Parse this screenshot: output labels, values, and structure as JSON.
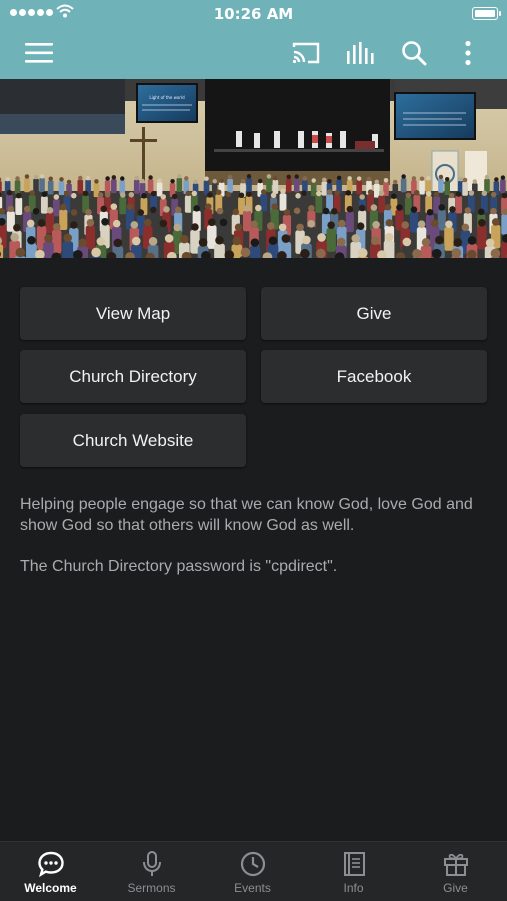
{
  "status_bar": {
    "time": "10:26 AM"
  },
  "app_bar": {
    "icons": [
      "menu-icon",
      "cast-icon",
      "audio-bars-icon",
      "search-icon",
      "more-vertical-icon"
    ]
  },
  "hero": {
    "screen_text": "Light of the world"
  },
  "actions": [
    {
      "label": "View Map"
    },
    {
      "label": "Give"
    },
    {
      "label": "Church Directory"
    },
    {
      "label": "Facebook"
    },
    {
      "label": "Church Website"
    }
  ],
  "description": {
    "mission": "Helping people engage so that we can know God, love God and show God so that others will know God as well.",
    "password_note": "The Church Directory password is \"cpdirect\"."
  },
  "tabs": [
    {
      "label": "Welcome",
      "icon": "chat-bubble-icon",
      "active": true
    },
    {
      "label": "Sermons",
      "icon": "microphone-icon",
      "active": false
    },
    {
      "label": "Events",
      "icon": "clock-icon",
      "active": false
    },
    {
      "label": "Info",
      "icon": "book-icon",
      "active": false
    },
    {
      "label": "Give",
      "icon": "gift-icon",
      "active": false
    }
  ],
  "colors": {
    "accent": "#6fb3b9",
    "background": "#1b1c1e",
    "button": "#2c2d2f"
  }
}
